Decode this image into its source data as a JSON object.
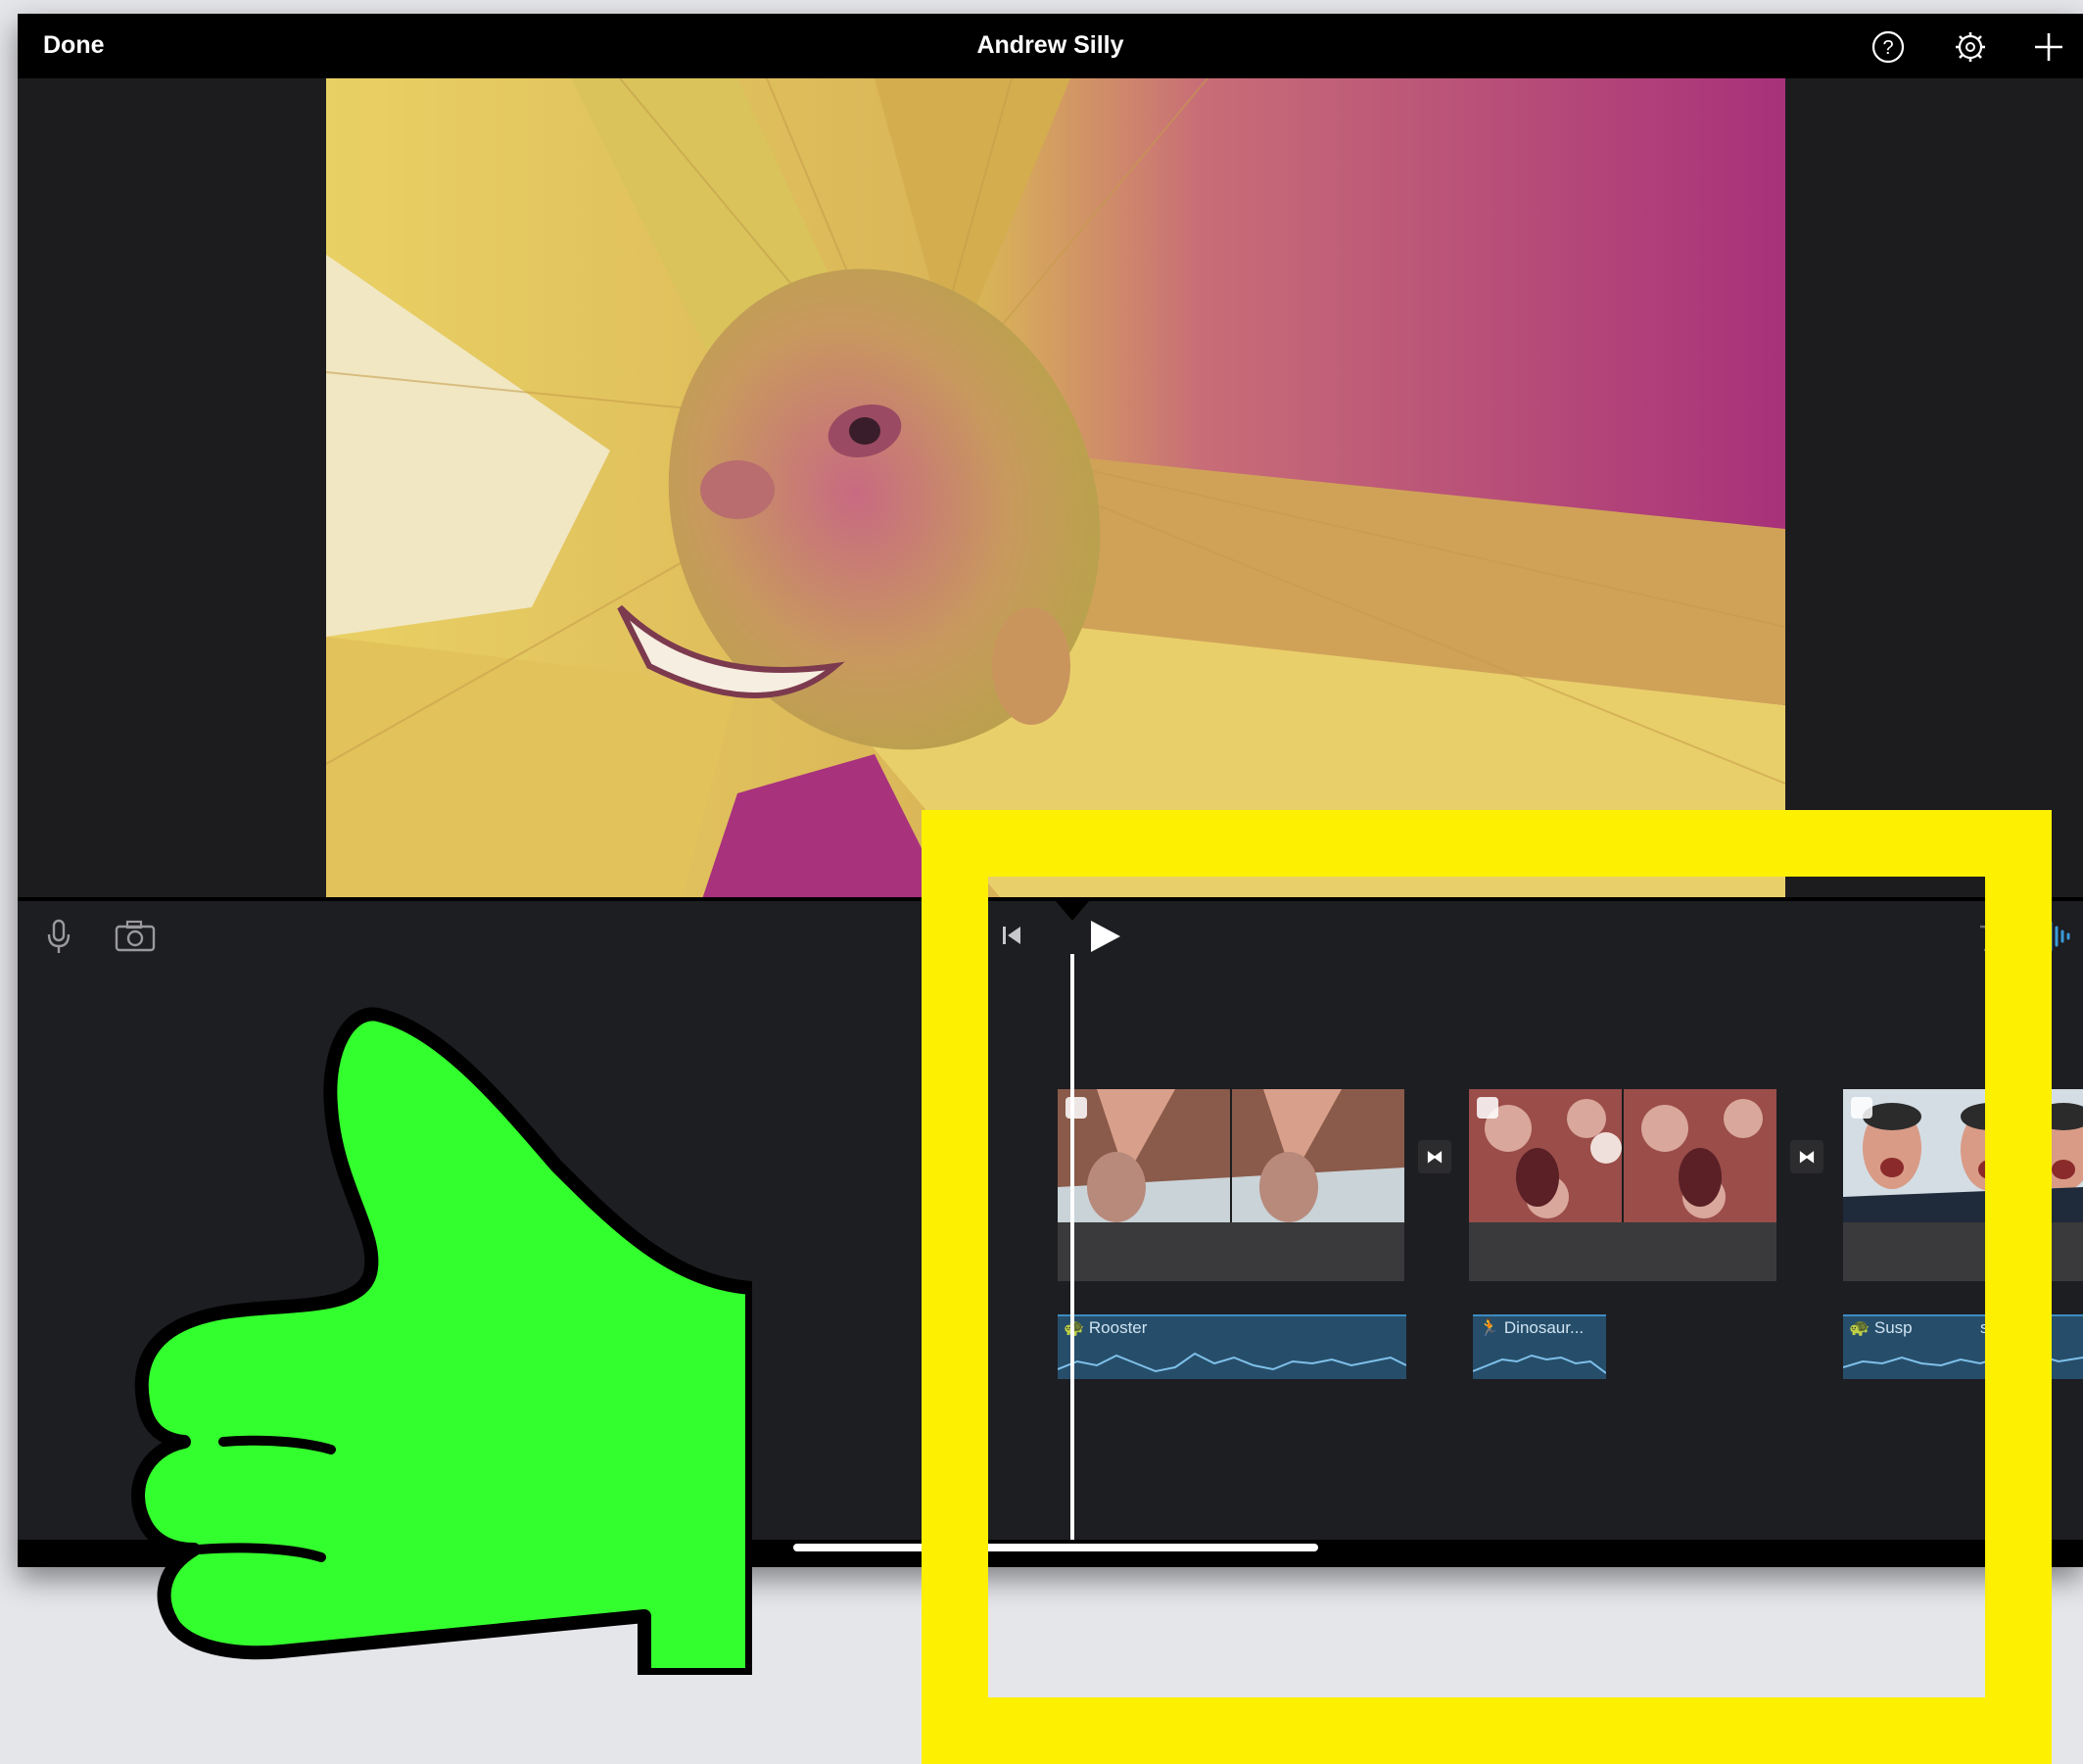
{
  "header": {
    "done_label": "Done",
    "title": "Andrew Silly",
    "icons": [
      "help-icon",
      "settings-icon",
      "add-icon"
    ]
  },
  "toolbar": {
    "left_icons": [
      "microphone-icon",
      "camera-icon"
    ],
    "right_icons": [
      "undo-icon",
      "audio-waveform-icon"
    ],
    "transport_icons": [
      "skip-to-start-icon",
      "play-icon"
    ]
  },
  "timeline": {
    "audio_clips": [
      {
        "label": "Rooster"
      },
      {
        "label": "Dinosaur..."
      },
      {
        "label": "Susp"
      },
      {
        "label": "sing"
      }
    ],
    "transition_icon": "transition-icon"
  },
  "annotations": {
    "highlight_color": "#fdf000",
    "thumb_color": "#34ff2e"
  },
  "colors": {
    "accent": "#3a9bd9",
    "background": "#1c1c1e"
  }
}
